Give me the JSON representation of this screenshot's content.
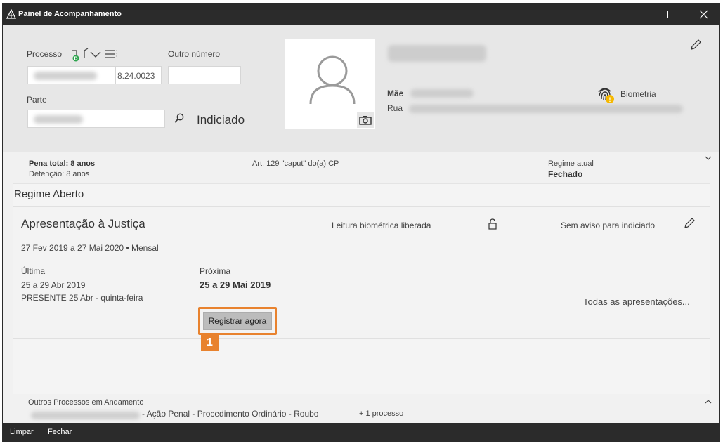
{
  "window": {
    "title": "Painel de Acompanhamento"
  },
  "processo": {
    "label": "Processo",
    "number_suffix": "8.24.0023",
    "outro_numero_label": "Outro número"
  },
  "parte": {
    "label": "Parte",
    "role": "Indiciado"
  },
  "person": {
    "mae_label": "Mãe",
    "rua_label": "Rua",
    "biometria_label": "Biometria"
  },
  "summary": {
    "pena_total": "Pena total: 8 anos",
    "detencao": "Detenção: 8 anos",
    "artigo": "Art. 129 \"caput\" do(a) CP",
    "regime_atual_label": "Regime atual",
    "regime_atual_value": "Fechado"
  },
  "regime": {
    "title": "Regime Aberto"
  },
  "apresentacao": {
    "title": "Apresentação à Justiça",
    "leitura": "Leitura biométrica liberada",
    "aviso": "Sem aviso para indiciado",
    "periodo": "27 Fev 2019 a 27 Mai 2020 • Mensal",
    "ultima_label": "Última",
    "ultima_value": "25 a 29 Abr 2019",
    "ultima_status": "PRESENTE 25 Abr - quinta-feira",
    "proxima_label": "Próxima",
    "proxima_value": "25 a 29 Mai 2019",
    "register_button": "Registrar agora",
    "todas_link": "Todas as apresentações...",
    "callout_number": "1"
  },
  "outros": {
    "title": "Outros Processos em Andamento",
    "description": "- Ação Penal - Procedimento Ordinário - Roubo",
    "count": "+ 1 processo"
  },
  "footer": {
    "limpar_first": "L",
    "limpar_rest": "impar",
    "fechar_first": "F",
    "fechar_rest": "echar"
  },
  "colors": {
    "titlebar": "#2b2b2b",
    "header_bg": "#e7e7e7",
    "accent_orange": "#e8822e",
    "badge_green": "#2da44e",
    "badge_yellow": "#f5b800"
  }
}
